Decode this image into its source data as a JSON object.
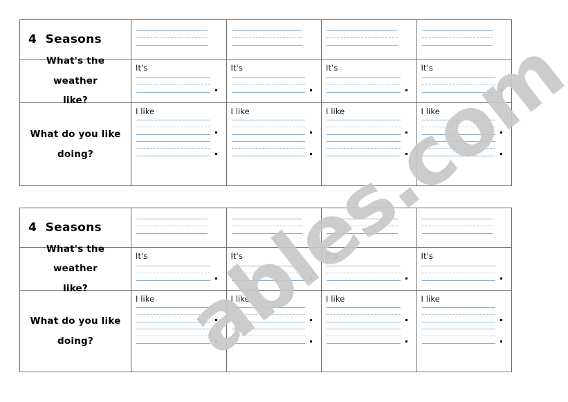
{
  "document": {
    "type": "worksheet",
    "title": "4  Seasons",
    "watermark": "ables.com",
    "colors": {
      "guide_line": "#8bb2cf",
      "guide_line_dashed": "#aecada",
      "table_border": "#6e6e6e",
      "watermark": "#c8c8c8",
      "text": "#000000",
      "page_background": "#ffffff"
    }
  },
  "worksheet": {
    "title": "4  Seasons",
    "rows": [
      {
        "id": "title-row",
        "label": "4  Seasons",
        "prompt": "",
        "guides_per_cell": 1,
        "has_period": false
      },
      {
        "id": "weather-row",
        "label_line_1": "What's the weather",
        "label_line_2": "like?",
        "prompt": "It's",
        "guides_per_cell": 1,
        "has_period": true
      },
      {
        "id": "like-row",
        "label_line_1": "What do you like",
        "label_line_2": "doing?",
        "prompt": "I like",
        "guides_per_cell": 2,
        "has_period": true
      }
    ],
    "columns": [
      {
        "id": "label-column",
        "label": ""
      },
      {
        "id": "season-column-1",
        "label": ""
      },
      {
        "id": "season-column-2",
        "label": ""
      },
      {
        "id": "season-column-3",
        "label": ""
      },
      {
        "id": "season-column-4",
        "label": ""
      }
    ],
    "copies": 2
  }
}
